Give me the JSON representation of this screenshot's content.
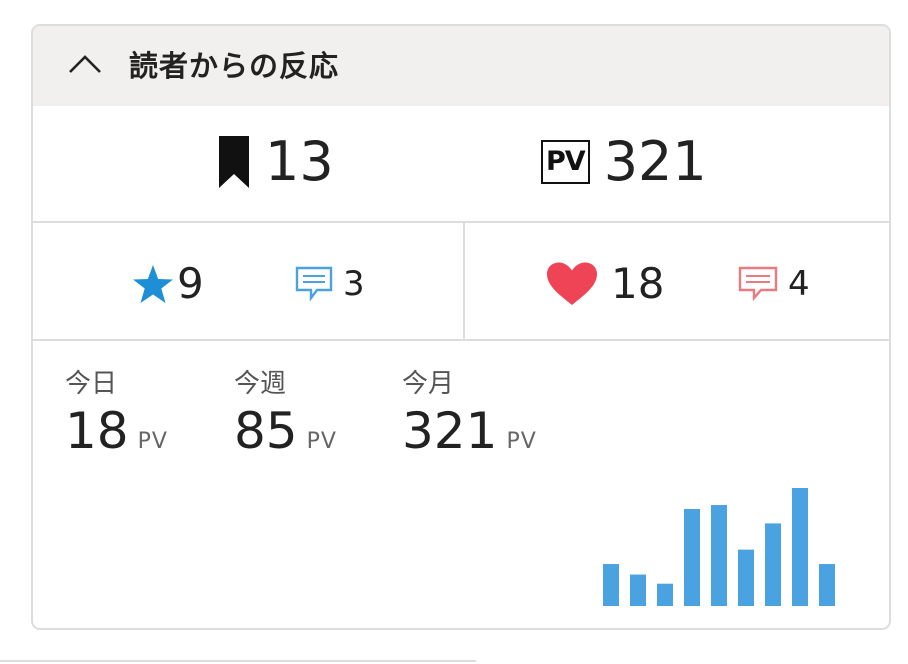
{
  "header": {
    "title": "読者からの反応",
    "toggle_icon": "chevron-up-icon"
  },
  "summary": {
    "bookmarks": "13",
    "pageviews": "321",
    "pv_icon_text": "PV"
  },
  "reactions": {
    "stars": "9",
    "star_comments": "3",
    "hearts": "18",
    "heart_comments": "4"
  },
  "periods": [
    {
      "label": "今日",
      "value": "18",
      "unit": "PV"
    },
    {
      "label": "今週",
      "value": "85",
      "unit": "PV"
    },
    {
      "label": "今月",
      "value": "321",
      "unit": "PV"
    }
  ],
  "colors": {
    "star": "#1e8fd6",
    "star_comment": "#4aa3e0",
    "heart": "#ee4455",
    "heart_comment": "#e87a80",
    "bar": "#4aa3e0",
    "header_bg": "#f2f0ef"
  },
  "chart_data": {
    "type": "bar",
    "values": [
      32,
      24,
      17,
      74,
      77,
      43,
      63,
      90,
      32
    ]
  }
}
